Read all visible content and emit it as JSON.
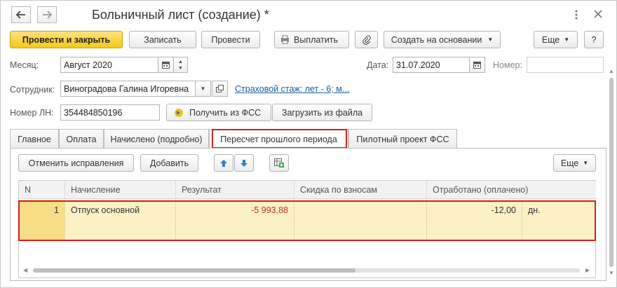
{
  "window": {
    "title": "Больничный лист (создание) *"
  },
  "toolbar": {
    "post_close": "Провести и закрыть",
    "save": "Записать",
    "post": "Провести",
    "pay": "Выплатить",
    "create_based": "Создать на основании",
    "more": "Еще",
    "help": "?"
  },
  "form": {
    "month_label": "Месяц:",
    "month_value": "Август 2020",
    "date_label": "Дата:",
    "date_value": "31.07.2020",
    "number_label": "Номер:",
    "number_value": "",
    "employee_label": "Сотрудник:",
    "employee_value": "Виноградова Галина Игоревна",
    "insurance_link": "Страховой стаж: лет - 6; м...",
    "ln_label": "Номер ЛН:",
    "ln_value": "354484850196",
    "get_fss": "Получить из ФСС",
    "load_file": "Загрузить из файла"
  },
  "tabs": [
    {
      "label": "Главное"
    },
    {
      "label": "Оплата"
    },
    {
      "label": "Начислено (подробно)"
    },
    {
      "label": "Пересчет прошлого периода"
    },
    {
      "label": "Пилотный проект ФСС"
    }
  ],
  "panel": {
    "cancel_fix": "Отменить исправления",
    "add": "Добавить",
    "more": "Еще"
  },
  "table": {
    "columns": [
      "N",
      "Начисление",
      "Результат",
      "Скидка по взносам",
      "Отработано (оплачено)"
    ],
    "rows": [
      {
        "n": "1",
        "accrual": "Отпуск основной",
        "result": "-5 993,88",
        "discount": "",
        "worked": "-12,00",
        "unit": "дн."
      }
    ]
  },
  "colors": {
    "primary_button": "#f6c915",
    "highlight": "#d61e1e",
    "row_selected": "#fbf1c4",
    "negative": "#c0312b",
    "link": "#1a5ba6"
  }
}
